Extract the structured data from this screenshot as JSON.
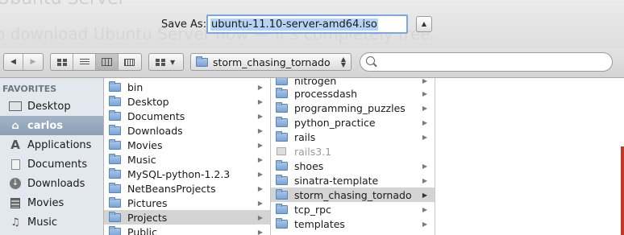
{
  "background_text": {
    "line1": "Ubuntu Server",
    "line2": "o download Ubuntu Server now — it's completely free."
  },
  "save": {
    "label": "Save As:",
    "filename": "ubuntu-11.10-server-amd64.iso",
    "expand_icon": "triangle-up-icon"
  },
  "toolbar": {
    "nav_back_icon": "◀",
    "nav_forward_icon": "▶",
    "arrange_caret": "▼",
    "path_current": "storm_chasing_tornado",
    "path_arrows": "⬍",
    "search_placeholder": ""
  },
  "sidebar": {
    "heading": "FAVORITES",
    "items": [
      {
        "label": "Desktop",
        "icon": "desktop-icon"
      },
      {
        "label": "carlos",
        "icon": "home-icon",
        "selected": true
      },
      {
        "label": "Applications",
        "icon": "applications-icon"
      },
      {
        "label": "Documents",
        "icon": "documents-icon"
      },
      {
        "label": "Downloads",
        "icon": "downloads-icon"
      },
      {
        "label": "Movies",
        "icon": "movies-icon"
      },
      {
        "label": "Music",
        "icon": "music-icon"
      }
    ]
  },
  "column1": {
    "items": [
      {
        "name": "bin",
        "has_children": true
      },
      {
        "name": "Desktop",
        "has_children": true
      },
      {
        "name": "Documents",
        "has_children": true
      },
      {
        "name": "Downloads",
        "has_children": true
      },
      {
        "name": "Movies",
        "has_children": true
      },
      {
        "name": "Music",
        "has_children": true
      },
      {
        "name": "MySQL-python-1.2.3",
        "has_children": true
      },
      {
        "name": "NetBeansProjects",
        "has_children": true
      },
      {
        "name": "Pictures",
        "has_children": true
      },
      {
        "name": "Projects",
        "has_children": true,
        "selected": true
      },
      {
        "name": "Public",
        "has_children": true
      }
    ]
  },
  "column2": {
    "items": [
      {
        "name": "nitrogen",
        "has_children": true
      },
      {
        "name": "processdash",
        "has_children": true
      },
      {
        "name": "programming_puzzles",
        "has_children": true
      },
      {
        "name": "python_practice",
        "has_children": true
      },
      {
        "name": "rails",
        "has_children": true
      },
      {
        "name": "rails3.1",
        "has_children": false,
        "dim": true
      },
      {
        "name": "shoes",
        "has_children": true
      },
      {
        "name": "sinatra-template",
        "has_children": true
      },
      {
        "name": "storm_chasing_tornado",
        "has_children": true,
        "selected": true
      },
      {
        "name": "tcp_rpc",
        "has_children": true
      },
      {
        "name": "templates",
        "has_children": true
      }
    ]
  },
  "colors": {
    "selection_blue": "#b4d3f7",
    "sidebar_selected": "#97a9bd",
    "folder_blue": "#7aa3d4"
  }
}
